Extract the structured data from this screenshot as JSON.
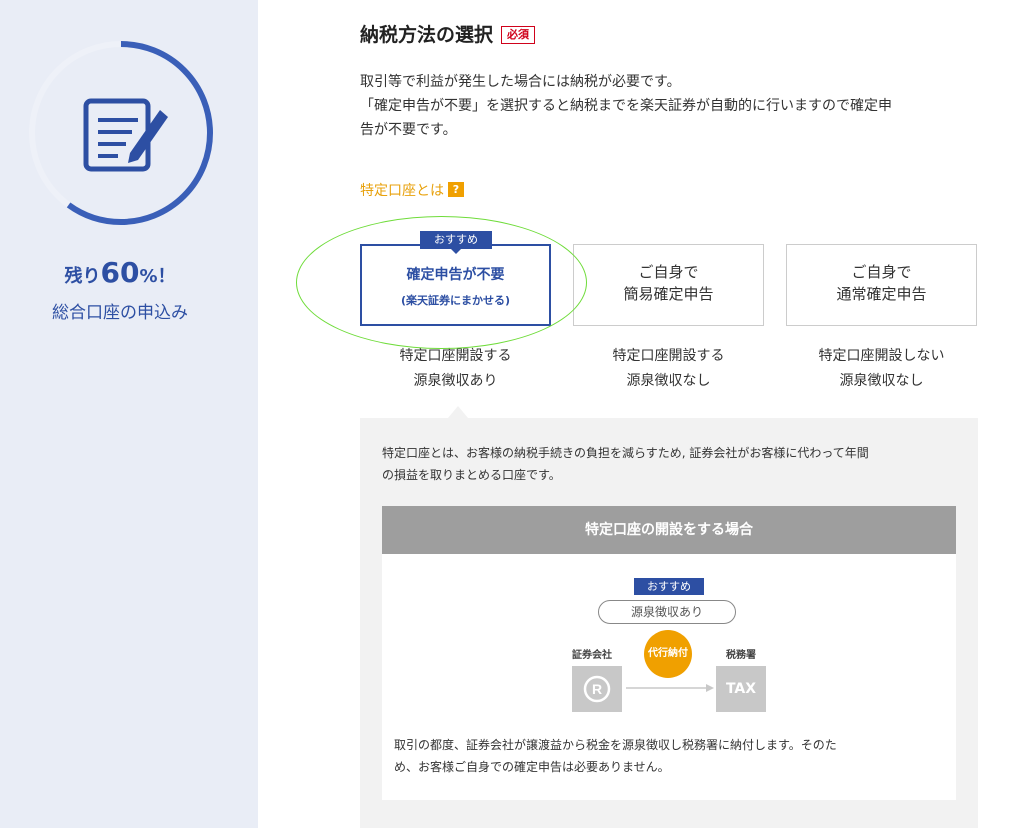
{
  "sidebar": {
    "remain_prefix": "残り",
    "remain_pct": "60",
    "remain_suffix": "%！",
    "caption": "総合口座の申込み",
    "progress": 0.6,
    "icon": "document-edit-icon"
  },
  "section": {
    "title": "納税方法の選択",
    "required": "必須",
    "intro_lines": [
      "取引等で利益が発生した場合には納税が必要です。",
      "「確定申告が不要」を選択すると納税までを楽天証券が自動的に行いますので確定申",
      "告が不要です。"
    ]
  },
  "help": {
    "label": "特定口座とは",
    "icon": "question-icon",
    "icon_glyph": "?"
  },
  "options": [
    {
      "tag": "おすすめ",
      "label": "確定申告が不要",
      "sublabel": "(楽天証券にまかせる)",
      "desc_line1": "特定口座開設する",
      "desc_line2": "源泉徴収あり"
    },
    {
      "label_line1": "ご自身で",
      "label_line2": "簡易確定申告",
      "desc_line1": "特定口座開設する",
      "desc_line2": "源泉徴収なし"
    },
    {
      "label_line1": "ご自身で",
      "label_line2": "通常確定申告",
      "desc_line1": "特定口座開設しない",
      "desc_line2": "源泉徴収なし"
    }
  ],
  "info": {
    "text_line1": "特定口座とは、お客様の納税手続きの負担を減らすため, 証券会社がお客様に代わって年間",
    "text_line2": "の損益を取りまとめる口座です。",
    "case_title": "特定口座の開設をする場合",
    "rec_tag": "おすすめ",
    "pill": "源泉徴収あり",
    "broker_label": "証券会社",
    "tax_label": "税務署",
    "broker_glyph": "R",
    "tax_glyph": "TAX",
    "pay_label": "代行納付",
    "case_line1": "取引の都度、証券会社が譲渡益から税金を源泉徴収し税務署に納付します。そのた",
    "case_line2": "め、お客様ご自身での確定申告は必要ありません。"
  },
  "colors": {
    "brand_blue": "#2d4fa3",
    "accent_orange": "#f0a000",
    "required_red": "#d0021b",
    "highlight_green": "#6fdc3a",
    "sidebar_bg": "#e9edf6"
  }
}
